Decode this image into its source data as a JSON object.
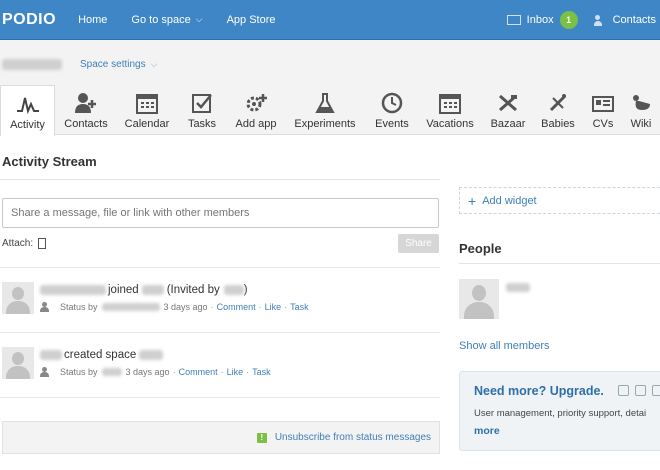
{
  "topbar": {
    "logo": "PODIO",
    "nav": [
      {
        "label": "Home"
      },
      {
        "label": "Go to space"
      },
      {
        "label": "App Store"
      }
    ],
    "inbox_label": "Inbox",
    "inbox_count": "1",
    "contacts_label": "Contacts"
  },
  "space": {
    "settings_label": "Space settings"
  },
  "apps": [
    {
      "label": "Activity",
      "icon": "activity-icon",
      "active": true
    },
    {
      "label": "Contacts",
      "icon": "contacts-icon"
    },
    {
      "label": "Calendar",
      "icon": "calendar-icon"
    },
    {
      "label": "Tasks",
      "icon": "tasks-icon"
    },
    {
      "label": "Add app",
      "icon": "add-app-icon"
    },
    {
      "label": "Experiments",
      "icon": "flask-icon"
    },
    {
      "label": "Events",
      "icon": "clock-icon"
    },
    {
      "label": "Vacations",
      "icon": "calendar-icon"
    },
    {
      "label": "Bazaar",
      "icon": "bazaar-icon"
    },
    {
      "label": "Babies",
      "icon": "babies-icon"
    },
    {
      "label": "CVs",
      "icon": "cv-icon"
    },
    {
      "label": "Wiki",
      "icon": "wiki-icon"
    }
  ],
  "stream": {
    "title": "Activity Stream",
    "share_placeholder": "Share a message, file or link with other members",
    "attach_label": "Attach:",
    "share_button": "Share",
    "items": [
      {
        "action": "joined",
        "invited_prefix": "(Invited by",
        "invited_suffix": ")",
        "status_prefix": "Status by",
        "time": "3 days ago",
        "links": [
          "Comment",
          "Like",
          "Task"
        ]
      },
      {
        "action": "created space",
        "status_prefix": "Status by",
        "time": "3 days ago",
        "links": [
          "Comment",
          "Like",
          "Task"
        ]
      }
    ],
    "unsubscribe_label": "Unsubscribe from status messages",
    "unsubscribe_icon": "!"
  },
  "sidebar": {
    "add_widget_label": "Add widget",
    "people_title": "People",
    "show_all_label": "Show all members",
    "upgrade_title": "Need more? Upgrade.",
    "upgrade_text": "User management, priority support, detai",
    "upgrade_more": "more"
  }
}
